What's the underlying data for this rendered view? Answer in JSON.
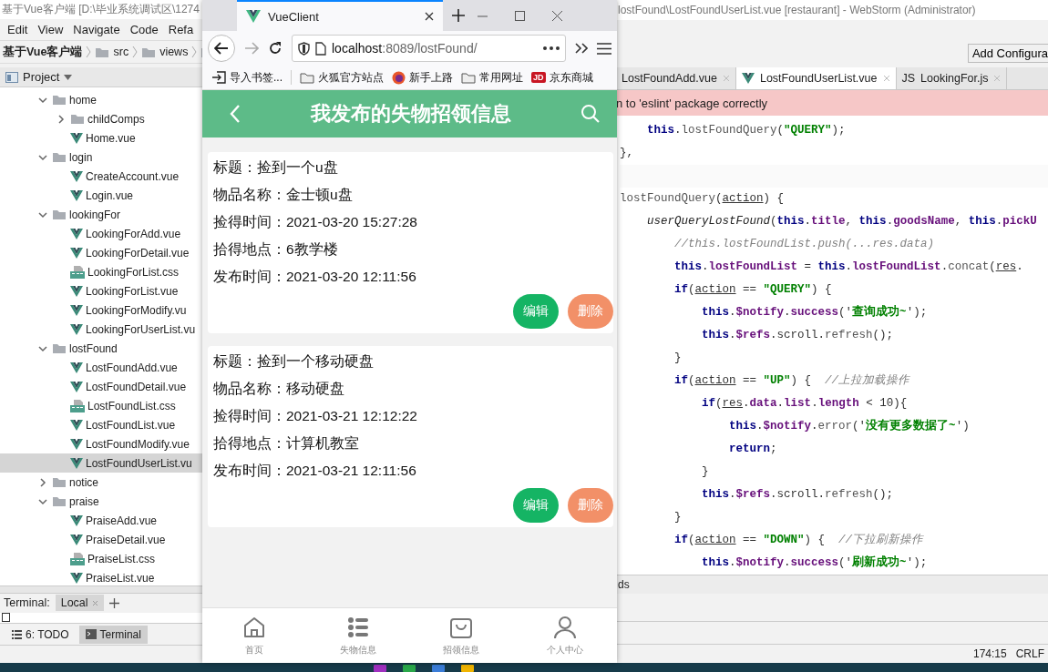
{
  "ide": {
    "title_left": "基于Vue客户端 [D:\\毕业系统调试区\\1274",
    "title_right": "lostFound\\LostFoundUserList.vue [restaurant] - WebStorm (Administrator)",
    "menu": [
      "Edit",
      "View",
      "Navigate",
      "Code",
      "Refa"
    ],
    "breadcrumb": [
      "基于Vue客户端",
      "src",
      "views"
    ],
    "run_config_button": "Add Configura",
    "project_panel": {
      "title": "Project",
      "tree": [
        {
          "name": "home",
          "kind": "folder",
          "expanded": true,
          "selected": false,
          "children": [
            {
              "name": "childComps",
              "kind": "folder",
              "expanded": false,
              "selected": false
            },
            {
              "name": "Home.vue",
              "kind": "vue",
              "selected": false
            }
          ]
        },
        {
          "name": "login",
          "kind": "folder",
          "expanded": true,
          "selected": false,
          "children": [
            {
              "name": "CreateAccount.vue",
              "kind": "vue",
              "selected": false
            },
            {
              "name": "Login.vue",
              "kind": "vue",
              "selected": false
            }
          ]
        },
        {
          "name": "lookingFor",
          "kind": "folder",
          "expanded": true,
          "selected": false,
          "children": [
            {
              "name": "LookingForAdd.vue",
              "kind": "vue",
              "selected": false
            },
            {
              "name": "LookingForDetail.vue",
              "kind": "vue",
              "selected": false
            },
            {
              "name": "LookingForList.css",
              "kind": "css",
              "selected": false
            },
            {
              "name": "LookingForList.vue",
              "kind": "vue",
              "selected": false
            },
            {
              "name": "LookingForModify.vu",
              "kind": "vue",
              "selected": false
            },
            {
              "name": "LookingForUserList.vu",
              "kind": "vue",
              "selected": false
            }
          ]
        },
        {
          "name": "lostFound",
          "kind": "folder",
          "expanded": true,
          "selected": false,
          "children": [
            {
              "name": "LostFoundAdd.vue",
              "kind": "vue",
              "selected": false
            },
            {
              "name": "LostFoundDetail.vue",
              "kind": "vue",
              "selected": false
            },
            {
              "name": "LostFoundList.css",
              "kind": "css",
              "selected": false
            },
            {
              "name": "LostFoundList.vue",
              "kind": "vue",
              "selected": false
            },
            {
              "name": "LostFoundModify.vue",
              "kind": "vue",
              "selected": false
            },
            {
              "name": "LostFoundUserList.vu",
              "kind": "vue",
              "selected": true
            }
          ]
        },
        {
          "name": "notice",
          "kind": "folder",
          "expanded": false,
          "selected": false
        },
        {
          "name": "praise",
          "kind": "folder",
          "expanded": true,
          "selected": false,
          "children": [
            {
              "name": "PraiseAdd.vue",
              "kind": "vue",
              "selected": false
            },
            {
              "name": "PraiseDetail.vue",
              "kind": "vue",
              "selected": false
            },
            {
              "name": "PraiseList.css",
              "kind": "css",
              "selected": false
            },
            {
              "name": "PraiseList.vue",
              "kind": "vue",
              "selected": false
            }
          ]
        }
      ]
    },
    "editor_tabs": [
      {
        "label": "LostFoundAdd.vue",
        "selected": false
      },
      {
        "label": "LostFoundUserList.vue",
        "kind": "vue",
        "selected": true
      },
      {
        "label": "LookingFor.js",
        "kind": "js",
        "selected": false
      }
    ],
    "js_badge": "JS",
    "banner": "n to 'eslint' package correctly",
    "code_lines": [
      {
        "tokens": [
          {
            "text": "    this",
            "kind": "kw"
          },
          {
            "text": ".",
            "kind": "plain"
          },
          {
            "text": "lostFoundQuery",
            "kind": "call"
          },
          {
            "text": "(",
            "kind": "plain"
          },
          {
            "text": "\"QUERY\"",
            "kind": "str"
          },
          {
            "text": ");",
            "kind": "plain"
          }
        ]
      },
      {
        "tokens": [
          {
            "text": "},",
            "kind": "plain"
          }
        ]
      },
      {
        "blank_before": true,
        "tokens": [
          {
            "text": "lostFoundQuery",
            "kind": "call"
          },
          {
            "text": "(",
            "kind": "plain"
          },
          {
            "text": "action",
            "kind": "param"
          },
          {
            "text": ") {",
            "kind": "plain"
          }
        ]
      },
      {
        "tokens": [
          {
            "text": "    userQueryLostFound",
            "kind": "ifn"
          },
          {
            "text": "(",
            "kind": "plain"
          },
          {
            "text": "this",
            "kind": "kw"
          },
          {
            "text": ".",
            "kind": "plain"
          },
          {
            "text": "title",
            "kind": "field"
          },
          {
            "text": ", ",
            "kind": "plain"
          },
          {
            "text": "this",
            "kind": "kw"
          },
          {
            "text": ".",
            "kind": "plain"
          },
          {
            "text": "goodsName",
            "kind": "field"
          },
          {
            "text": ", ",
            "kind": "plain"
          },
          {
            "text": "this",
            "kind": "kw"
          },
          {
            "text": ".",
            "kind": "plain"
          },
          {
            "text": "pickU",
            "kind": "field"
          }
        ]
      },
      {
        "tokens": [
          {
            "text": "        //this.lostFoundList.push(...res.data)",
            "kind": "comment"
          }
        ]
      },
      {
        "tokens": [
          {
            "text": "        this",
            "kind": "kw"
          },
          {
            "text": ".",
            "kind": "plain"
          },
          {
            "text": "lostFoundList",
            "kind": "field"
          },
          {
            "text": " = ",
            "kind": "plain"
          },
          {
            "text": "this",
            "kind": "kw"
          },
          {
            "text": ".",
            "kind": "plain"
          },
          {
            "text": "lostFoundList",
            "kind": "field"
          },
          {
            "text": ".",
            "kind": "plain"
          },
          {
            "text": "concat",
            "kind": "call"
          },
          {
            "text": "(",
            "kind": "plain"
          },
          {
            "text": "res",
            "kind": "param"
          },
          {
            "text": ".",
            "kind": "plain"
          }
        ]
      },
      {
        "tokens": [
          {
            "text": "        if",
            "kind": "kw"
          },
          {
            "text": "(",
            "kind": "plain"
          },
          {
            "text": "action",
            "kind": "param"
          },
          {
            "text": " == ",
            "kind": "plain"
          },
          {
            "text": "\"QUERY\"",
            "kind": "str"
          },
          {
            "text": ") {",
            "kind": "plain"
          }
        ]
      },
      {
        "tokens": [
          {
            "text": "            this",
            "kind": "kw"
          },
          {
            "text": ".",
            "kind": "plain"
          },
          {
            "text": "$notify",
            "kind": "field"
          },
          {
            "text": ".",
            "kind": "plain"
          },
          {
            "text": "success",
            "kind": "field"
          },
          {
            "text": "('",
            "kind": "plain"
          },
          {
            "text": "查询成功~",
            "kind": "str"
          },
          {
            "text": "');",
            "kind": "plain"
          }
        ]
      },
      {
        "tokens": [
          {
            "text": "            this",
            "kind": "kw"
          },
          {
            "text": ".",
            "kind": "plain"
          },
          {
            "text": "$refs",
            "kind": "field"
          },
          {
            "text": ".scroll.",
            "kind": "plain"
          },
          {
            "text": "refresh",
            "kind": "call"
          },
          {
            "text": "();",
            "kind": "plain"
          }
        ]
      },
      {
        "tokens": [
          {
            "text": "        }",
            "kind": "plain"
          }
        ]
      },
      {
        "tokens": [
          {
            "text": "        if",
            "kind": "kw"
          },
          {
            "text": "(",
            "kind": "plain"
          },
          {
            "text": "action",
            "kind": "param"
          },
          {
            "text": " == ",
            "kind": "plain"
          },
          {
            "text": "\"UP\"",
            "kind": "str"
          },
          {
            "text": ") {  ",
            "kind": "plain"
          },
          {
            "text": "//上拉加载操作",
            "kind": "comment"
          }
        ]
      },
      {
        "tokens": [
          {
            "text": "            if",
            "kind": "kw"
          },
          {
            "text": "(",
            "kind": "plain"
          },
          {
            "text": "res",
            "kind": "param"
          },
          {
            "text": ".",
            "kind": "plain"
          },
          {
            "text": "data",
            "kind": "field"
          },
          {
            "text": ".",
            "kind": "plain"
          },
          {
            "text": "list",
            "kind": "field"
          },
          {
            "text": ".",
            "kind": "plain"
          },
          {
            "text": "length",
            "kind": "field"
          },
          {
            "text": " < 10){",
            "kind": "plain"
          }
        ]
      },
      {
        "tokens": [
          {
            "text": "                this",
            "kind": "kw"
          },
          {
            "text": ".",
            "kind": "plain"
          },
          {
            "text": "$notify",
            "kind": "field"
          },
          {
            "text": ".",
            "kind": "plain"
          },
          {
            "text": "error",
            "kind": "call"
          },
          {
            "text": "('",
            "kind": "plain"
          },
          {
            "text": "没有更多数据了~",
            "kind": "str"
          },
          {
            "text": "')",
            "kind": "plain"
          }
        ]
      },
      {
        "tokens": [
          {
            "text": "                return",
            "kind": "kw"
          },
          {
            "text": ";",
            "kind": "plain"
          }
        ]
      },
      {
        "tokens": [
          {
            "text": "            }",
            "kind": "plain"
          }
        ]
      },
      {
        "tokens": [
          {
            "text": "            this",
            "kind": "kw"
          },
          {
            "text": ".",
            "kind": "plain"
          },
          {
            "text": "$refs",
            "kind": "field"
          },
          {
            "text": ".scroll.",
            "kind": "plain"
          },
          {
            "text": "refresh",
            "kind": "call"
          },
          {
            "text": "();",
            "kind": "plain"
          }
        ]
      },
      {
        "tokens": [
          {
            "text": "        }",
            "kind": "plain"
          }
        ]
      },
      {
        "tokens": [
          {
            "text": "        if",
            "kind": "kw"
          },
          {
            "text": "(",
            "kind": "plain"
          },
          {
            "text": "action",
            "kind": "param"
          },
          {
            "text": " == ",
            "kind": "plain"
          },
          {
            "text": "\"DOWN\"",
            "kind": "str"
          },
          {
            "text": ") {  ",
            "kind": "plain"
          },
          {
            "text": "//下拉刷新操作",
            "kind": "comment"
          }
        ]
      },
      {
        "tokens": [
          {
            "text": "            this",
            "kind": "kw"
          },
          {
            "text": ".",
            "kind": "plain"
          },
          {
            "text": "$notify",
            "kind": "field"
          },
          {
            "text": ".",
            "kind": "plain"
          },
          {
            "text": "success",
            "kind": "field"
          },
          {
            "text": "('",
            "kind": "plain"
          },
          {
            "text": "刷新成功~",
            "kind": "str"
          },
          {
            "text": "');",
            "kind": "plain"
          }
        ]
      }
    ],
    "tool_window_label": "ds",
    "terminal": {
      "label": "Terminal:",
      "tabs": [
        {
          "label": "Local",
          "selected": true
        }
      ]
    },
    "tool_strip": [
      {
        "label": "6: TODO",
        "kind": "todo",
        "selected": false
      },
      {
        "label": "Terminal",
        "kind": "terminal",
        "selected": true
      }
    ],
    "status": [
      "174:15",
      "CRLF"
    ]
  },
  "browser": {
    "tab": {
      "title": "VueClient",
      "selected": true
    },
    "url_host": "localhost",
    "url_path": ":8089/lostFound/",
    "bookmarks": [
      {
        "label": "导入书签...",
        "kind": "import"
      },
      {
        "label": "火狐官方站点",
        "kind": "folder"
      },
      {
        "label": "新手上路",
        "kind": "firefox"
      },
      {
        "label": "常用网址",
        "kind": "folder"
      },
      {
        "label": "京东商城",
        "kind": "jd",
        "badge": "JD"
      }
    ],
    "page": {
      "title": "我发布的失物招领信息",
      "cards": [
        {
          "lines": [
            "标题：捡到一个u盘",
            "物品名称：金士顿u盘",
            "捡得时间：2021-03-20 15:27:28",
            "拾得地点：6教学楼",
            "发布时间：2021-03-20 12:11:56"
          ],
          "buttons": [
            {
              "label": "编辑",
              "kind": "edit"
            },
            {
              "label": "删除",
              "kind": "delete"
            }
          ]
        },
        {
          "lines": [
            "标题：捡到一个移动硬盘",
            "物品名称：移动硬盘",
            "捡得时间：2021-03-21 12:12:22",
            "拾得地点：计算机教室",
            "发布时间：2021-03-21 12:11:56"
          ],
          "buttons": [
            {
              "label": "编辑",
              "kind": "edit"
            },
            {
              "label": "删除",
              "kind": "delete"
            }
          ]
        }
      ],
      "tabbar": [
        {
          "label": "首页",
          "kind": "home"
        },
        {
          "label": "失物信息",
          "kind": "list"
        },
        {
          "label": "招领信息",
          "kind": "bag"
        },
        {
          "label": "个人中心",
          "kind": "person"
        }
      ]
    }
  }
}
